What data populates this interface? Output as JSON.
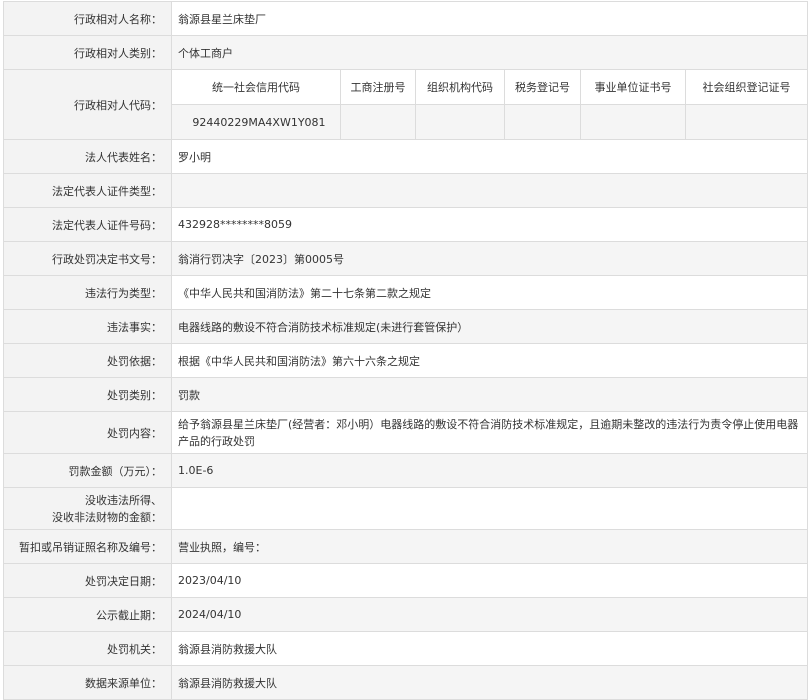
{
  "rows": {
    "name": {
      "label": "行政相对人名称：",
      "value": "翁源县星兰床垫厂"
    },
    "category": {
      "label": "行政相对人类别：",
      "value": "个体工商户"
    },
    "code": {
      "label": "行政相对人代码：",
      "headers": [
        "统一社会信用代码",
        "工商注册号",
        "组织机构代码",
        "税务登记号",
        "事业单位证书号",
        "社会组织登记证号"
      ],
      "values": [
        "92440229MA4XW1Y081",
        "",
        "",
        "",
        "",
        ""
      ]
    },
    "legal_rep": {
      "label": "法人代表姓名：",
      "value": "罗小明"
    },
    "id_type": {
      "label": "法定代表人证件类型：",
      "value": ""
    },
    "id_number": {
      "label": "法定代表人证件号码：",
      "value": "432928********8059"
    },
    "doc_number": {
      "label": "行政处罚决定书文号：",
      "value": "翁消行罚决字〔2023〕第0005号"
    },
    "violation_type": {
      "label": "违法行为类型：",
      "value": "《中华人民共和国消防法》第二十七条第二款之规定"
    },
    "facts": {
      "label": "违法事实：",
      "value": "电器线路的敷设不符合消防技术标准规定(未进行套管保护）"
    },
    "basis": {
      "label": "处罚依据：",
      "value": "根据《中华人民共和国消防法》第六十六条之规定"
    },
    "penalty_type": {
      "label": "处罚类别：",
      "value": "罚款"
    },
    "content": {
      "label": "处罚内容：",
      "value": "给予翁源县星兰床垫厂(经营者：邓小明）电器线路的敷设不符合消防技术标准规定，且逾期未整改的违法行为责令停止使用电器产品的行政处罚"
    },
    "fine": {
      "label": "罚款金额（万元）：",
      "value": "1.0E-6"
    },
    "confiscated": {
      "label_line1": "没收违法所得、",
      "label_line2": "没收非法财物的金额：",
      "value": ""
    },
    "license": {
      "label": "暂扣或吊销证照名称及编号：",
      "value": "营业执照，编号："
    },
    "decision_date": {
      "label": "处罚决定日期：",
      "value": "2023/04/10"
    },
    "publicity_end": {
      "label": "公示截止期：",
      "value": "2024/04/10"
    },
    "authority": {
      "label": "处罚机关：",
      "value": "翁源县消防救援大队"
    },
    "source": {
      "label": "数据来源单位：",
      "value": "翁源县消防救援大队"
    }
  }
}
